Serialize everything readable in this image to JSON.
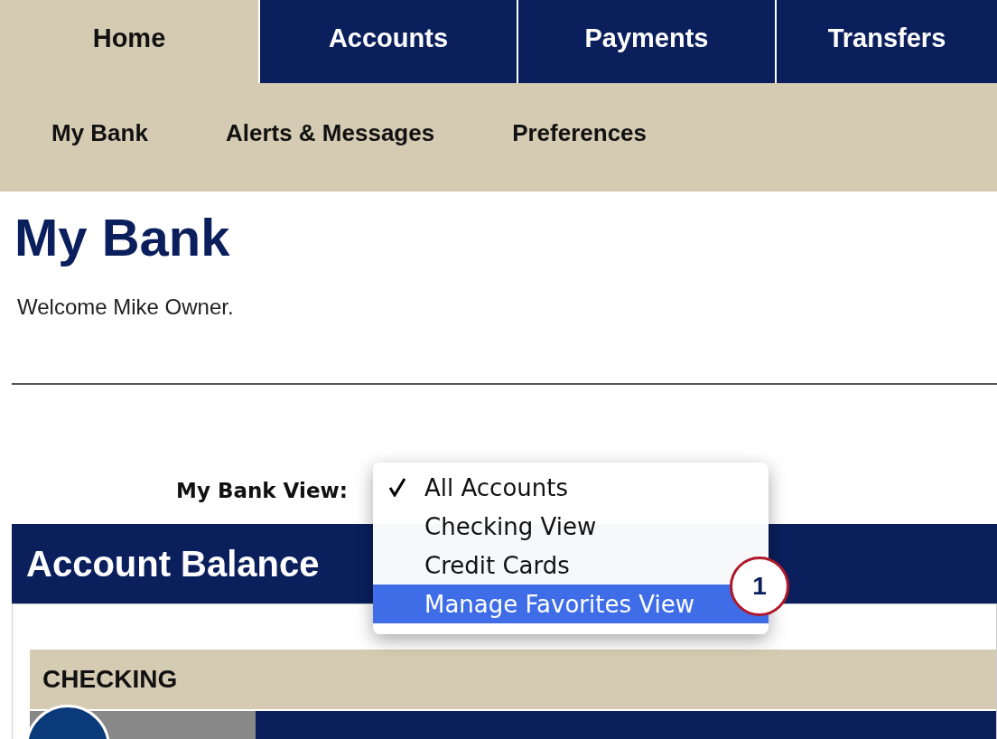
{
  "tabs": [
    {
      "label": "Home",
      "selected": true
    },
    {
      "label": "Accounts",
      "selected": false
    },
    {
      "label": "Payments",
      "selected": false
    },
    {
      "label": "Transfers",
      "selected": false
    }
  ],
  "subnav": [
    "My Bank",
    "Alerts & Messages",
    "Preferences"
  ],
  "page_title": "My Bank",
  "welcome": "Welcome Mike Owner.",
  "view_label": "My Bank View:",
  "view_menu": [
    {
      "label": "All Accounts",
      "checked": true,
      "highlighted": false
    },
    {
      "label": "Checking View",
      "checked": false,
      "highlighted": false
    },
    {
      "label": "Credit Cards",
      "checked": false,
      "highlighted": false
    },
    {
      "label": "Manage Favorites View",
      "checked": false,
      "highlighted": true
    }
  ],
  "callout": "1",
  "panel_title": "Account Balance",
  "section": "CHECKING"
}
